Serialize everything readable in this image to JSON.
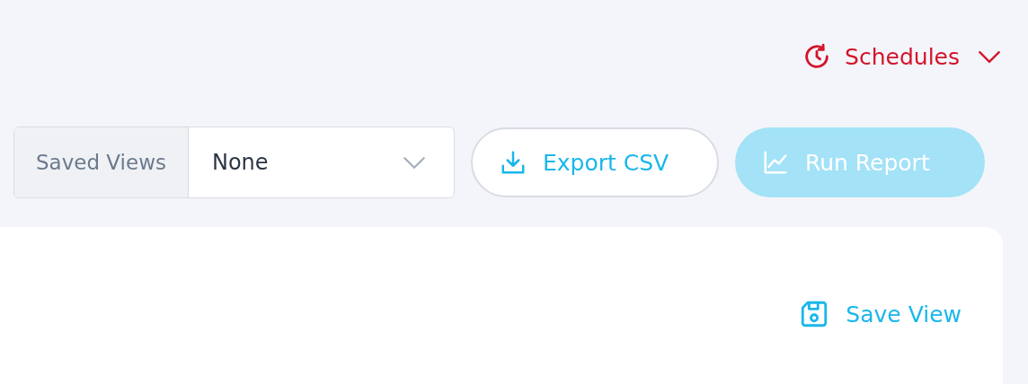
{
  "schedules": {
    "label": "Schedules",
    "expanded": false
  },
  "saved_views": {
    "label": "Saved Views",
    "value": "None"
  },
  "buttons": [
    {
      "kind": "export",
      "label": "Export CSV",
      "disabled": false
    },
    {
      "kind": "run",
      "label": "Run Report",
      "disabled": true
    }
  ],
  "card": {
    "save_view": "Save View"
  }
}
